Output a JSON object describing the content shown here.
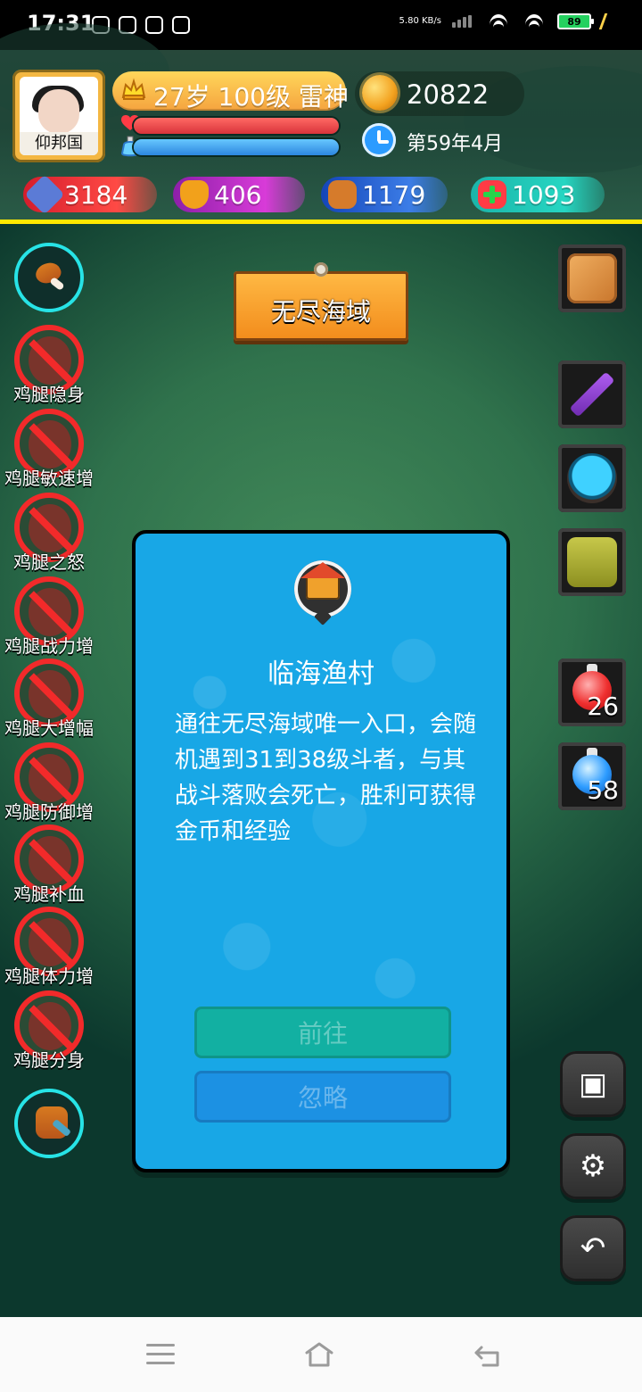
{
  "status_bar": {
    "time": "17:31",
    "network_speed": "5.80 KB/s",
    "battery": "89"
  },
  "player": {
    "name": "仰邦国",
    "level_line": "27岁 100级 雷神",
    "gold": "20822",
    "date": "第59年4月",
    "stats": {
      "attack": "3184",
      "defense": "406",
      "speed": "1179",
      "health": "1093"
    }
  },
  "location": {
    "signboard": "无尽海域"
  },
  "buffs": [
    "鸡腿隐身",
    "鸡腿敏速增",
    "鸡腿之怒",
    "鸡腿战力增",
    "鸡腿大增幅",
    "鸡腿防御增",
    "鸡腿补血",
    "鸡腿体力增",
    "鸡腿分身"
  ],
  "inventory": {
    "red_potion_count": "26",
    "blue_potion_count": "58"
  },
  "dialog": {
    "title": "临海渔村",
    "description": "通往无尽海域唯一入口，会随机遇到31到38级斗者，与其战斗落败会死亡，胜利可获得金币和经验",
    "go_button": "前往",
    "ignore_button": "忽略"
  }
}
